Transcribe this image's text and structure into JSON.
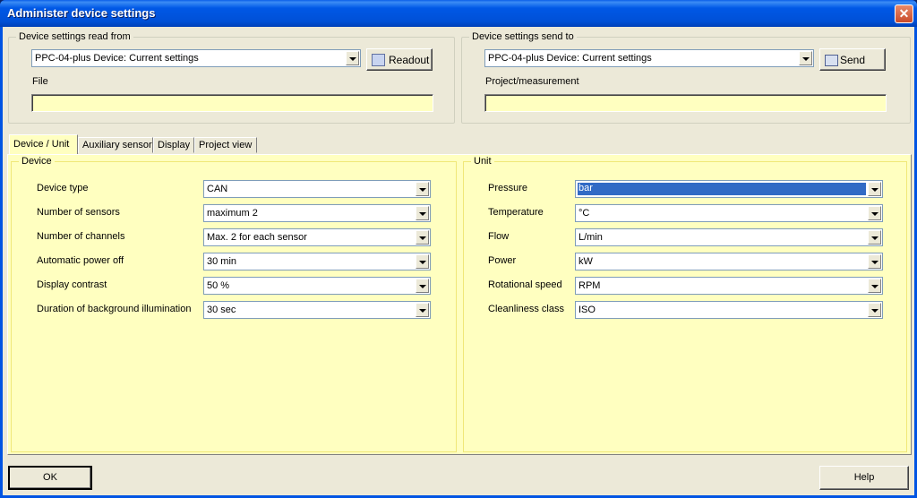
{
  "window": {
    "title": "Administer device settings"
  },
  "read_from": {
    "group_label": "Device settings read from",
    "source_value": "PPC-04-plus Device: Current settings",
    "readout_label": "Readout",
    "file_label": "File",
    "file_value": ""
  },
  "send_to": {
    "group_label": "Device settings send to",
    "target_value": "PPC-04-plus Device: Current settings",
    "send_label": "Send",
    "project_label": "Project/measurement",
    "project_value": ""
  },
  "tabs": [
    {
      "label": "Device / Unit",
      "active": true
    },
    {
      "label": "Auxiliary sensor",
      "active": false
    },
    {
      "label": "Display",
      "active": false
    },
    {
      "label": "Project view",
      "active": false
    }
  ],
  "device": {
    "group_label": "Device",
    "rows": [
      {
        "label": "Device type",
        "value": "CAN"
      },
      {
        "label": "Number of sensors",
        "value": "maximum 2"
      },
      {
        "label": "Number of channels",
        "value": "Max. 2 for each sensor"
      },
      {
        "label": "Automatic power off",
        "value": "30 min"
      },
      {
        "label": "Display contrast",
        "value": "50 %"
      },
      {
        "label": "Duration of background illumination",
        "value": "30 sec"
      }
    ]
  },
  "unit": {
    "group_label": "Unit",
    "rows": [
      {
        "label": "Pressure",
        "value": "bar"
      },
      {
        "label": "Temperature",
        "value": "°C"
      },
      {
        "label": "Flow",
        "value": "L/min"
      },
      {
        "label": "Power",
        "value": "kW"
      },
      {
        "label": "Rotational speed",
        "value": "RPM"
      },
      {
        "label": "Cleanliness class",
        "value": "ISO"
      }
    ]
  },
  "footer": {
    "ok_label": "OK",
    "help_label": "Help"
  },
  "colors": {
    "titlebar": "#0054e3",
    "panel": "#ffffc0",
    "selection": "#316ac5"
  }
}
